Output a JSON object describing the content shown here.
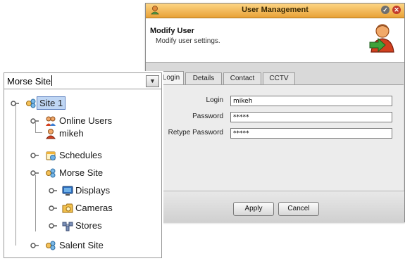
{
  "dialog": {
    "title": "User Management",
    "header_title": "Modify User",
    "header_subtitle": "Modify user settings.",
    "tabs": [
      "Login",
      "Details",
      "Contact",
      "CCTV"
    ],
    "active_tab": "Login",
    "fields": [
      {
        "label": "Login",
        "value": "mikeh"
      },
      {
        "label": "Password",
        "value": "*****"
      },
      {
        "label": "Retype Password",
        "value": "*****"
      }
    ],
    "buttons": {
      "apply": "Apply",
      "cancel": "Cancel"
    },
    "colors": {
      "titlebar": "#f2b74e",
      "panel": "#ececec"
    }
  },
  "tree": {
    "combo_value": "Morse Site",
    "items": [
      {
        "label": "Site 1",
        "icon": "site-icon",
        "selected": true
      },
      {
        "label": "Online Users",
        "icon": "users-icon"
      },
      {
        "label": "mikeh",
        "icon": "user-icon"
      },
      {
        "label": "Schedules",
        "icon": "schedules-icon"
      },
      {
        "label": "Morse Site",
        "icon": "site-icon"
      },
      {
        "label": "Displays",
        "icon": "display-icon"
      },
      {
        "label": "Cameras",
        "icon": "camera-icon"
      },
      {
        "label": "Stores",
        "icon": "store-icon"
      },
      {
        "label": "Salent Site",
        "icon": "site-icon"
      }
    ],
    "colors": {
      "selection": "#bfd6f4"
    }
  }
}
